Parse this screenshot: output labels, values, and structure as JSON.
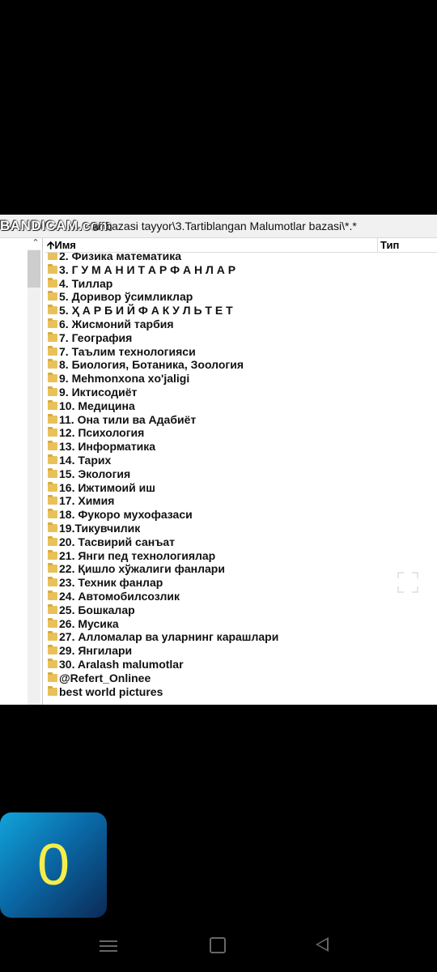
{
  "titlebar": {
    "watermark": "BANDICAM.com",
    "path": "ar bazasi tayyor\\3.Tartiblangan Malumotlar bazasi\\*.*"
  },
  "columns": {
    "name": "Имя",
    "type": "Тип",
    "sort_icon": "arrow-up-icon"
  },
  "files": [
    "2. Физика математика",
    "3. Г У М А Н И Т А Р           Ф А Н Л А Р",
    "4. Тиллар",
    "5. Доривор ўсимликлар",
    "5. Ҳ А Р Б И Й        Ф А К У Л Ь Т Е Т",
    "6. Жисмоний тарбия",
    "7. География",
    "7.  Таълим технологияси",
    "8. Биология, Ботаника, Зоология",
    "9. Mehmonxona xo'jaligi",
    "9. Иктисодиёт",
    "10. Медицина",
    "11. Она тили ва Адабиёт",
    "12. Психология",
    "13. Информатика",
    "14. Тарих",
    "15. Экология",
    "16. Ижтимоий иш",
    "17. Химия",
    "18. Фукоро мухофазаси",
    "19.Тикувчилик",
    "20. Тасвирий санъат",
    "21. Янги пед технологиялар",
    "22. Қишло хўжалиги фанлари",
    "23. Техник фанлар",
    "24. Автомобилсозлик",
    "25. Бошкалар",
    "26. Мусика",
    "27. Алломалар ва уларнинг карашлари",
    "29. Янгилари",
    "30. Aralash malumotlar",
    "@Refert_Onlinee",
    "best world pictures"
  ],
  "counter": {
    "value": "0"
  },
  "icons": {
    "folder": "folder-icon",
    "expand": "fullscreen-icon",
    "nav": [
      "menu-icon",
      "home-icon",
      "back-icon"
    ]
  }
}
